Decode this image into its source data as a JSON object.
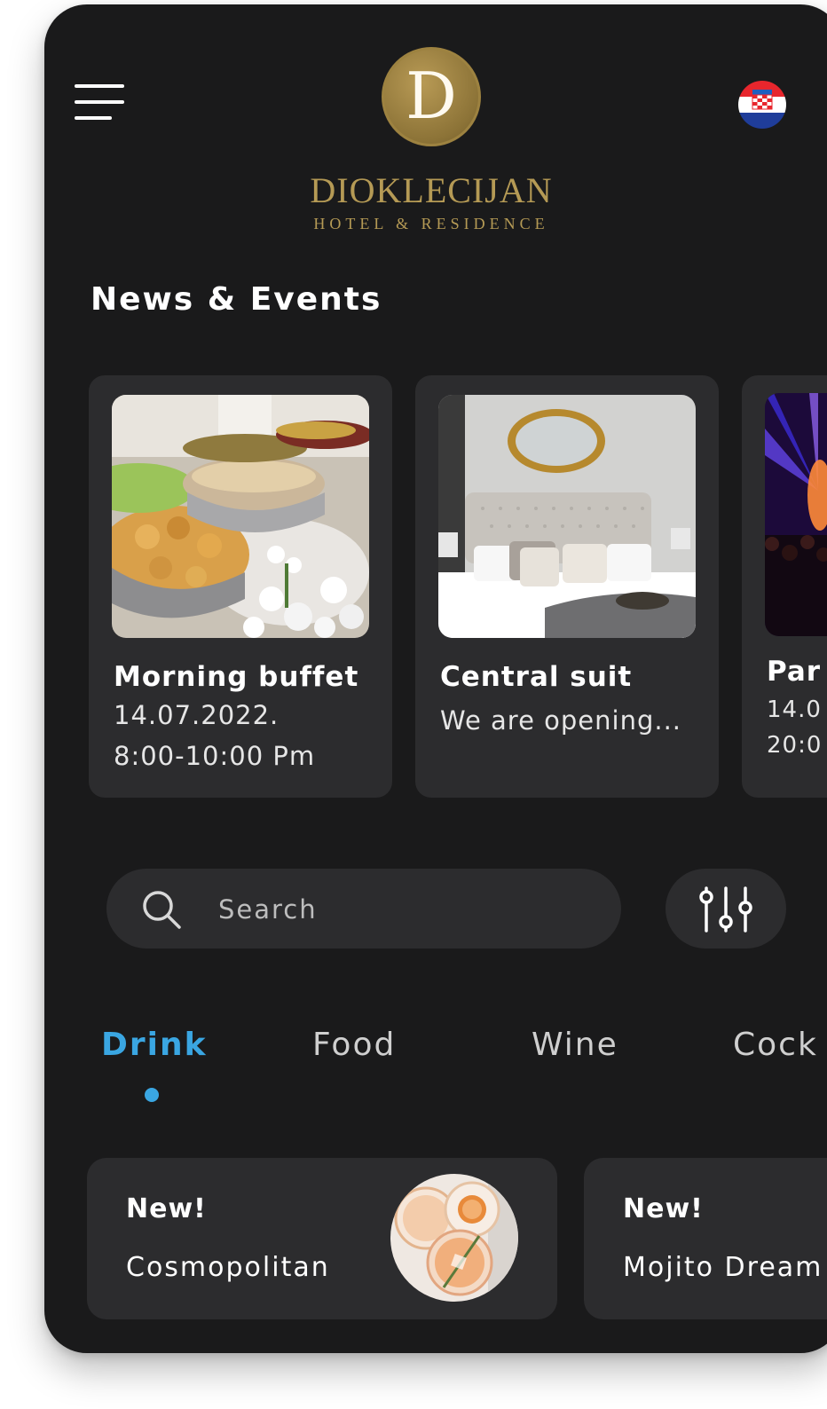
{
  "header": {
    "logo_letter": "D",
    "brand_name": "DIOKLECIJAN",
    "brand_subtitle": "HOTEL & RESIDENCE"
  },
  "section_title": "News & Events",
  "events": [
    {
      "title": "Morning buffet",
      "line1": "14.07.2022.",
      "line2": "8:00-10:00 Pm"
    },
    {
      "title": "Central suit",
      "line1": "We are opening...",
      "line2": ""
    },
    {
      "title": "Par",
      "line1": "14.0",
      "line2": "20:0"
    }
  ],
  "search": {
    "placeholder": "Search"
  },
  "tabs": [
    {
      "label": "Drink",
      "active": true
    },
    {
      "label": "Food",
      "active": false
    },
    {
      "label": "Wine",
      "active": false
    },
    {
      "label": "Cock",
      "active": false
    }
  ],
  "drinks": [
    {
      "badge": "New!",
      "name": "Cosmopolitan"
    },
    {
      "badge": "New!",
      "name": "Mojito Dream"
    }
  ],
  "colors": {
    "background": "#1a1a1b",
    "card": "#2c2c2e",
    "accent": "#3aa6e2",
    "gold": "#b59a55"
  },
  "icons": {
    "menu": "hamburger-menu-icon",
    "language": "croatia-flag-icon",
    "search": "search-icon",
    "filter": "filter-sliders-icon"
  }
}
